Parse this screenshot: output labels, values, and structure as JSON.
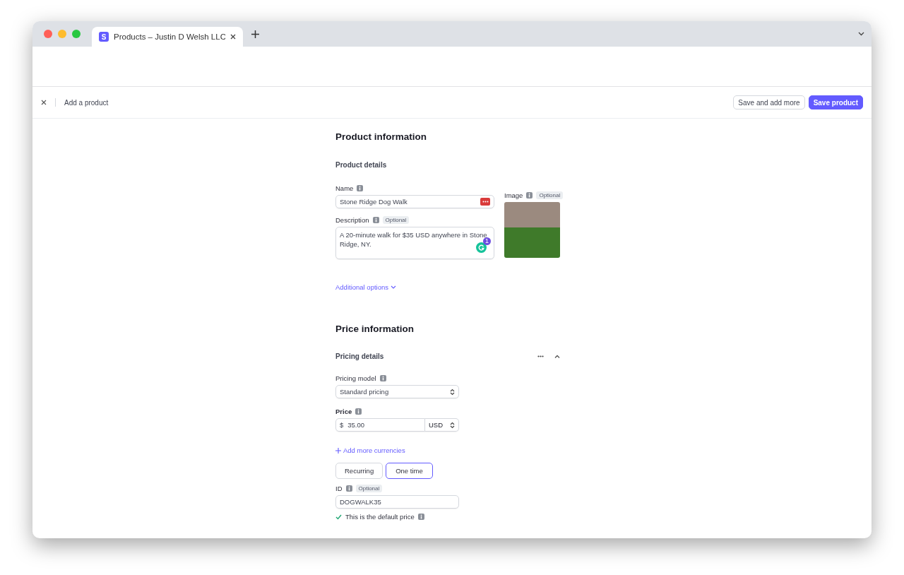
{
  "browser": {
    "favicon_letter": "S",
    "tab_title": "Products – Justin D Welsh LLC"
  },
  "topbar": {
    "title": "Add a product",
    "buttons": [
      {
        "label": "Save and add more",
        "kind": "secondary"
      },
      {
        "label": "Save product",
        "kind": "primary"
      }
    ]
  },
  "product_information": {
    "heading": "Product information",
    "subheading": "Product details",
    "name": {
      "label": "Name",
      "value": "Stone Ridge Dog Walk"
    },
    "description": {
      "label": "Description",
      "badge": "Optional",
      "value": "A 20-minute walk for $35 USD anywhere in Stone Ridge, NY.",
      "grammar_count": "1"
    },
    "image": {
      "label": "Image",
      "badge": "Optional"
    },
    "additional_options": "Additional options"
  },
  "price_information": {
    "heading": "Price information",
    "subheading": "Pricing details",
    "expanded": true,
    "pricing_model": {
      "label": "Pricing model",
      "value": "Standard pricing"
    },
    "price": {
      "label": "Price",
      "symbol": "$",
      "value": "35.00",
      "currency": "USD"
    },
    "add_currencies": "Add more currencies",
    "billing": [
      {
        "label": "Recurring",
        "selected": false
      },
      {
        "label": "One time",
        "selected": true
      }
    ],
    "id": {
      "label": "ID",
      "badge": "Optional",
      "value": "DOGWALK35"
    },
    "default_price": {
      "label": "This is the default price",
      "checked": true
    }
  }
}
